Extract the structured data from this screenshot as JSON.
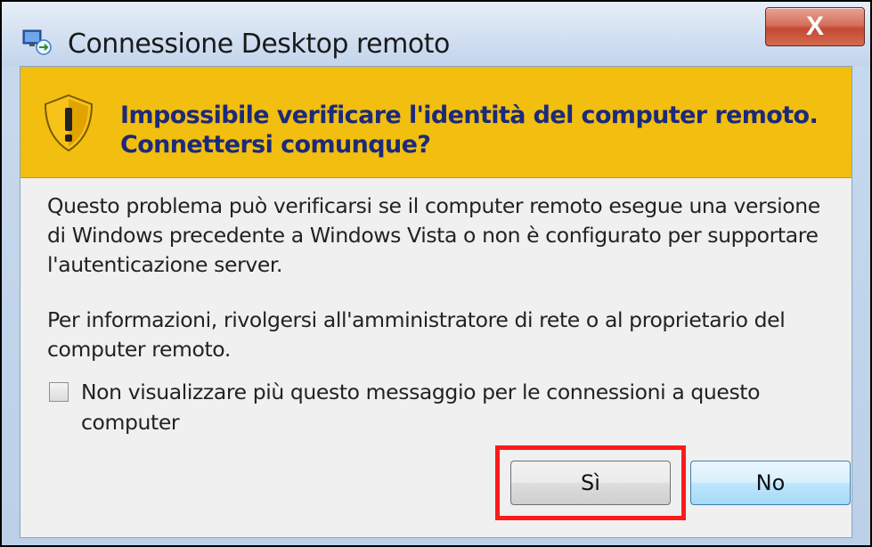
{
  "window": {
    "title": "Connessione Desktop remoto",
    "close_label": "X",
    "icon": "remote-desktop-icon"
  },
  "warning": {
    "icon": "shield-warning-icon",
    "heading_line1": "Impossibile verificare l'identità del computer remoto.",
    "heading_line2": "Connettersi comunque?"
  },
  "body": {
    "paragraph1": "Questo problema può verificarsi se il computer remoto esegue una versione di Windows precedente a Windows Vista o non è configurato per supportare l'autenticazione server.",
    "paragraph2": "Per informazioni, rivolgersi all'amministratore di rete o al proprietario del computer remoto."
  },
  "checkbox": {
    "label": "Non visualizzare più questo messaggio per le connessioni a questo computer",
    "checked": false
  },
  "buttons": {
    "yes_label": "Sì",
    "no_label": "No"
  },
  "colors": {
    "warning_band": "#f2be0f",
    "heading_text": "#1b2a7a",
    "highlight": "#ff1a1a"
  }
}
